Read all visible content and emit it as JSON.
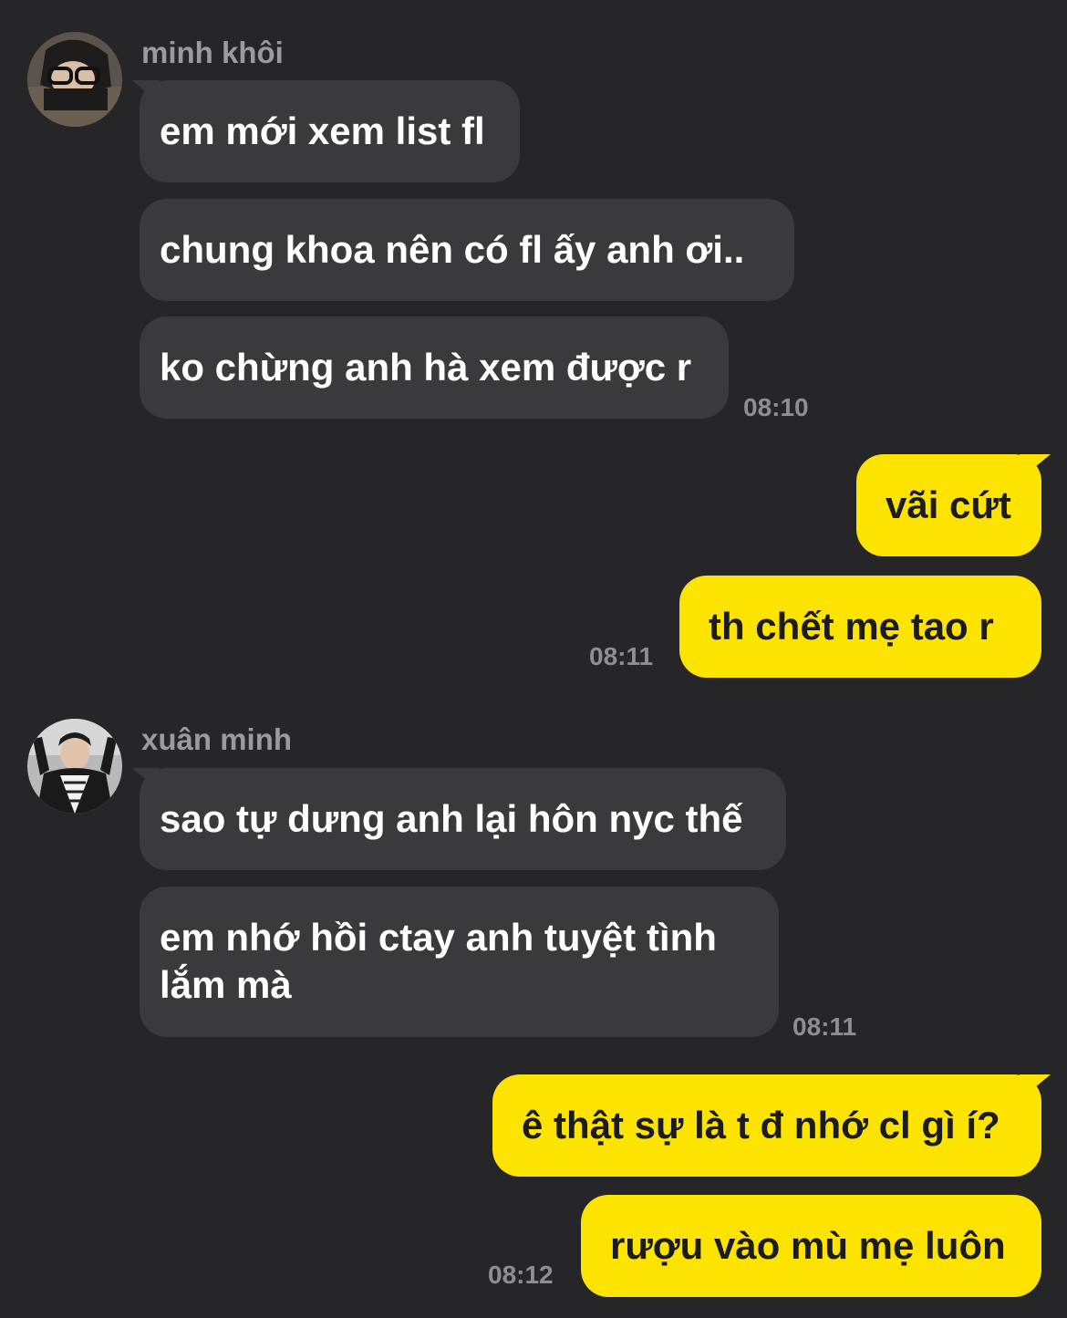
{
  "conversation": {
    "groups": [
      {
        "sender": "minh khôi",
        "messages": [
          "em mới xem list fl",
          "chung khoa nên có fl ấy anh ơi..",
          "ko chừng anh hà xem được r"
        ],
        "time": "08:10"
      },
      {
        "sender": "me",
        "messages": [
          "vãi cứt",
          "th chết mẹ tao r"
        ],
        "time": "08:11"
      },
      {
        "sender": "xuân minh",
        "messages": [
          "sao tự dưng anh lại hôn nyc thế",
          "em nhớ hồi ctay anh tuyệt tình lắm mà"
        ],
        "time": "08:11"
      },
      {
        "sender": "me",
        "messages": [
          "ê thật sự là t đ nhớ cl gì í?",
          "rượu vào mù mẹ luôn"
        ],
        "time": "08:12"
      }
    ]
  },
  "colors": {
    "background": "#262628",
    "incoming_bubble": "#3a3a3c",
    "outgoing_bubble": "#fde300",
    "timestamp": "#8e8e93",
    "sender_name": "#9b9b9f"
  }
}
